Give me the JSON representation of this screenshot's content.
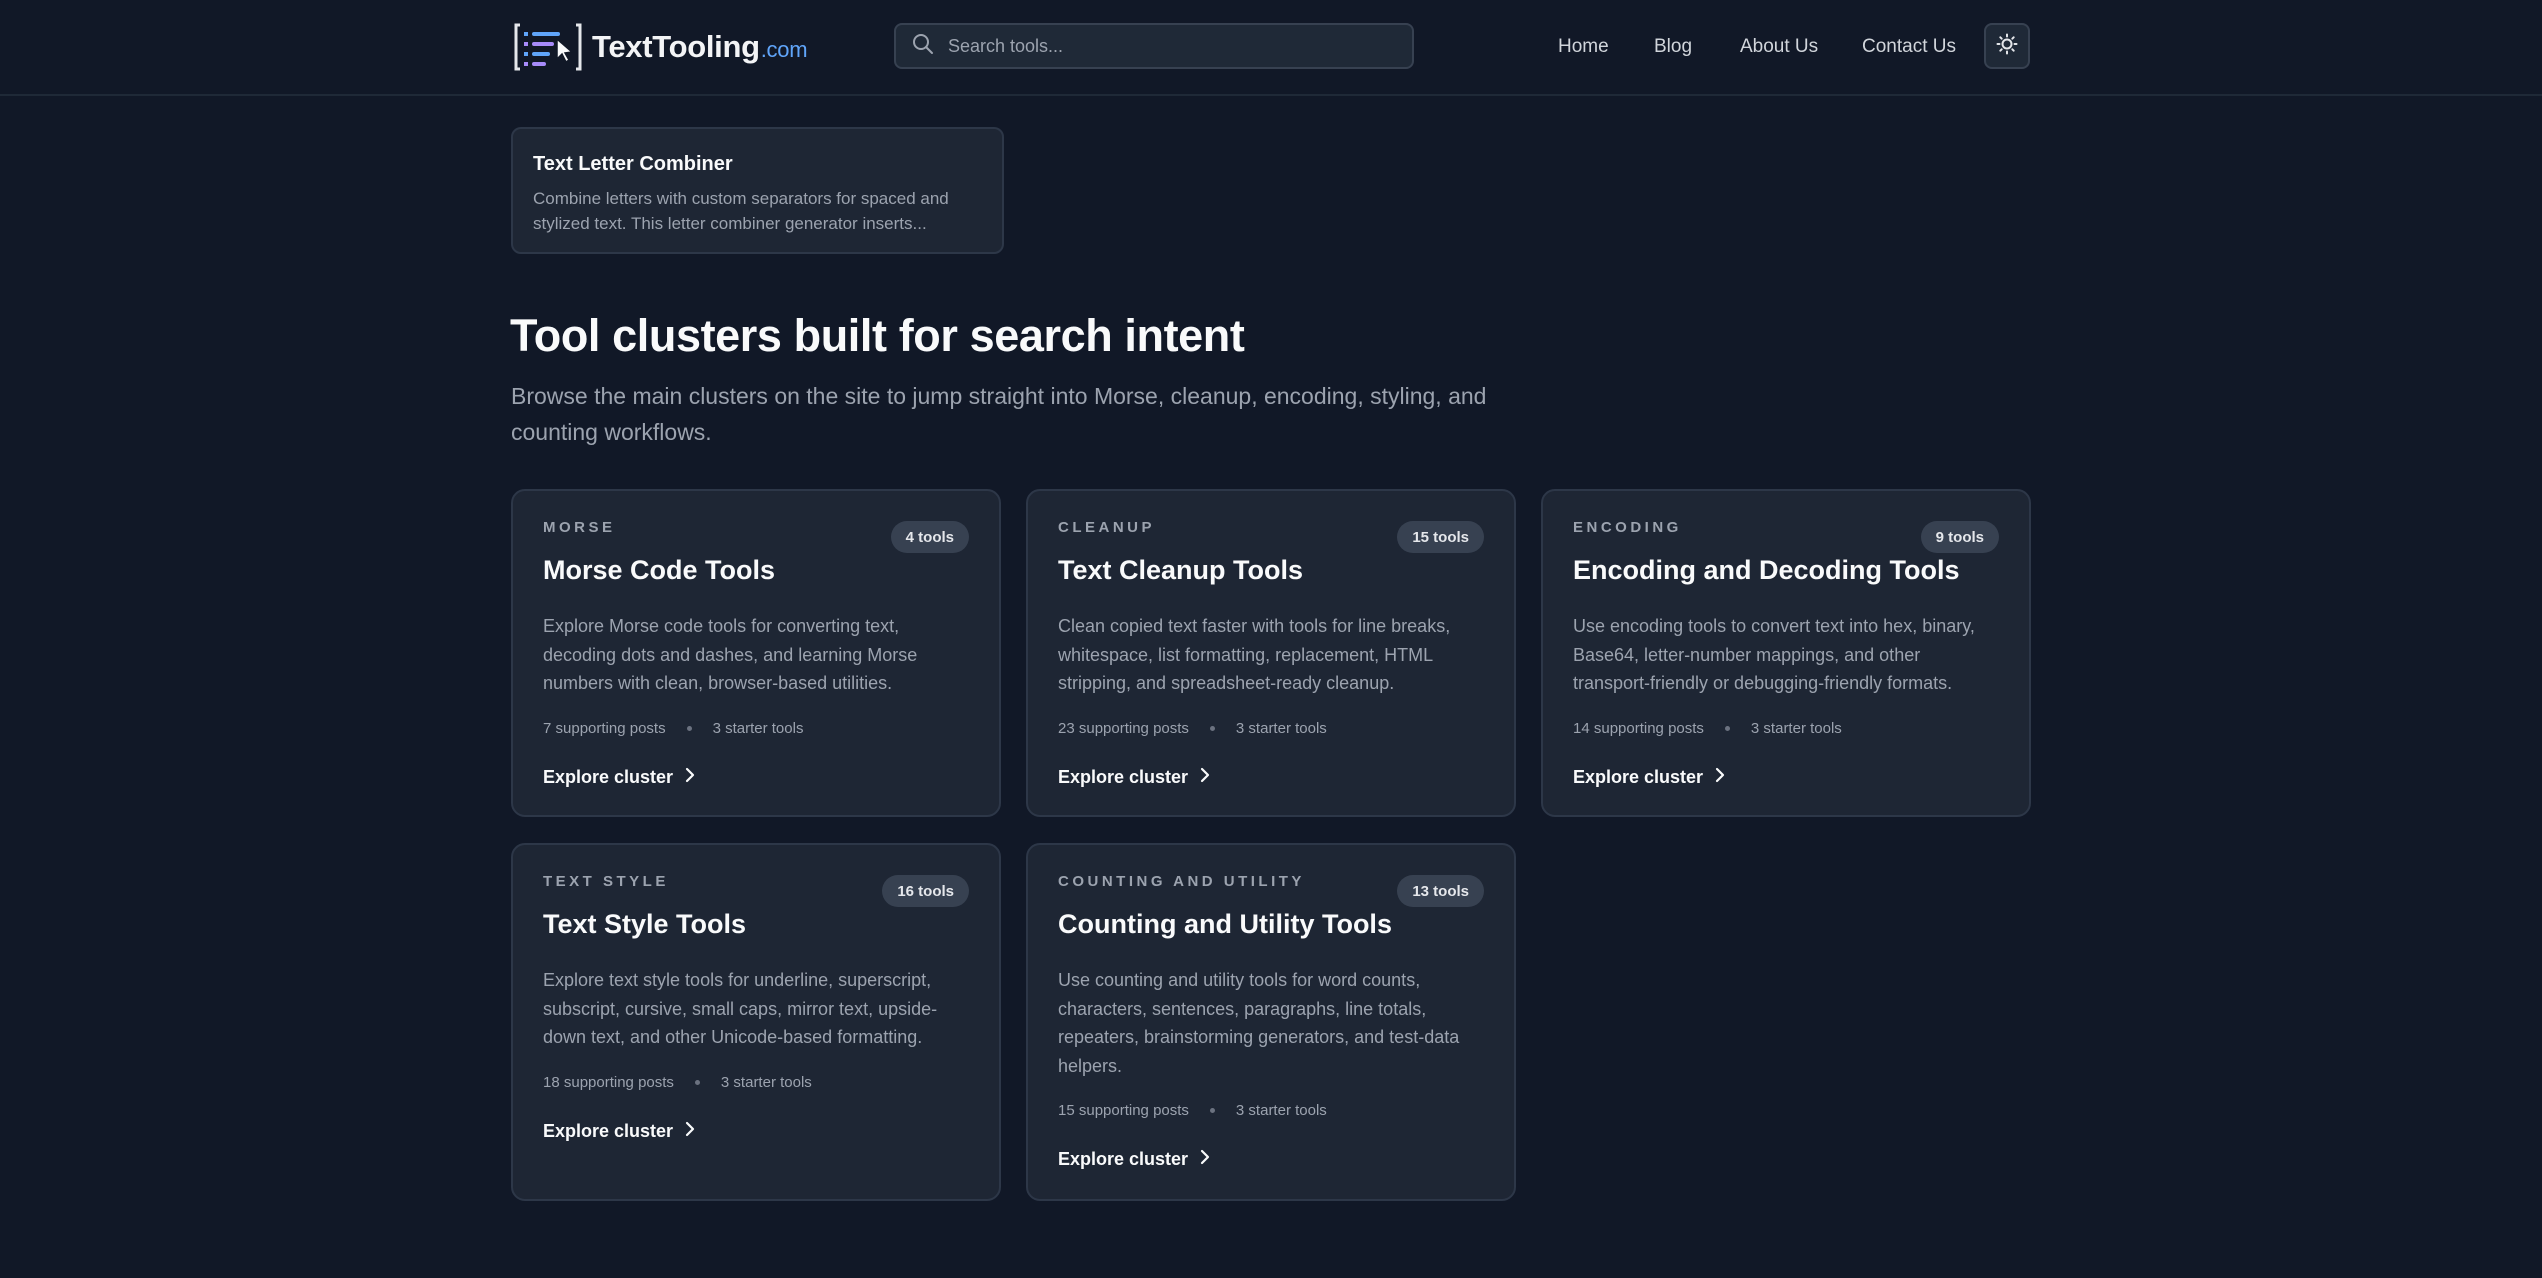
{
  "header": {
    "logo_name": "TextTooling",
    "logo_tld": ".com",
    "search_placeholder": "Search tools...",
    "nav": [
      "Home",
      "Blog",
      "About Us",
      "Contact Us"
    ]
  },
  "top_card": {
    "title": "Text Letter Combiner",
    "description": "Combine letters with custom separators for spaced and stylized text. This letter combiner generator inserts..."
  },
  "section": {
    "title": "Tool clusters built for search intent",
    "subtitle": "Browse the main clusters on the site to jump straight into Morse, cleanup, encoding, styling, and counting workflows."
  },
  "clusters": [
    {
      "category": "MORSE",
      "badge": "4 tools",
      "title": "Morse Code Tools",
      "description": "Explore Morse code tools for converting text, decoding dots and dashes, and learning Morse numbers with clean, browser-based utilities.",
      "posts": "7 supporting posts",
      "starters": "3 starter tools",
      "cta": "Explore cluster"
    },
    {
      "category": "CLEANUP",
      "badge": "15 tools",
      "title": "Text Cleanup Tools",
      "description": "Clean copied text faster with tools for line breaks, whitespace, list formatting, replacement, HTML stripping, and spreadsheet-ready cleanup.",
      "posts": "23 supporting posts",
      "starters": "3 starter tools",
      "cta": "Explore cluster"
    },
    {
      "category": "ENCODING",
      "badge": "9 tools",
      "title": "Encoding and Decoding Tools",
      "description": "Use encoding tools to convert text into hex, binary, Base64, letter-number mappings, and other transport-friendly or debugging-friendly formats.",
      "posts": "14 supporting posts",
      "starters": "3 starter tools",
      "cta": "Explore cluster"
    },
    {
      "category": "TEXT STYLE",
      "badge": "16 tools",
      "title": "Text Style Tools",
      "description": "Explore text style tools for underline, superscript, subscript, cursive, small caps, mirror text, upside-down text, and other Unicode-based formatting.",
      "posts": "18 supporting posts",
      "starters": "3 starter tools",
      "cta": "Explore cluster"
    },
    {
      "category": "COUNTING AND UTILITY",
      "badge": "13 tools",
      "title": "Counting and Utility Tools",
      "description": "Use counting and utility tools for word counts, characters, sentences, paragraphs, line totals, repeaters, brainstorming generators, and test-data helpers.",
      "posts": "15 supporting posts",
      "starters": "3 starter tools",
      "cta": "Explore cluster"
    }
  ],
  "icons": {
    "search": "search-icon",
    "theme": "sun-icon",
    "chevron": "chevron-right-icon"
  },
  "colors": {
    "background": "#111827",
    "card": "#1e2634",
    "accent": "#60a5fa"
  }
}
